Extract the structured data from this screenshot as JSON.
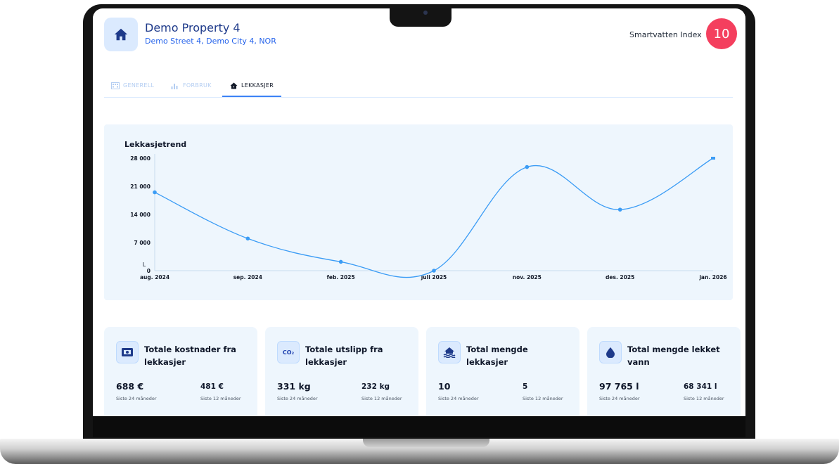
{
  "header": {
    "title": "Demo Property 4",
    "address": "Demo Street 4, Demo City 4, NOR",
    "index_label": "Smartvatten Index",
    "index_value": "10"
  },
  "tabs": [
    {
      "label": "GENERELL",
      "icon": "building-icon",
      "active": false
    },
    {
      "label": "FORBRUK",
      "icon": "bar-chart-icon",
      "active": false
    },
    {
      "label": "LEKKASJER",
      "icon": "house-leak-icon",
      "active": true
    }
  ],
  "chart_data": {
    "type": "line",
    "title": "Lekkasjetrend",
    "ylabel": "L",
    "xlabel": "",
    "categories": [
      "aug. 2024",
      "sep. 2024",
      "feb. 2025",
      "juli 2025",
      "nov. 2025",
      "des. 2025",
      "jan. 2026"
    ],
    "values": [
      19500,
      8000,
      2200,
      0,
      25800,
      15200,
      28000
    ],
    "y_ticks": [
      "0",
      "7 000",
      "14 000",
      "21 000",
      "28 000"
    ],
    "ylim": [
      0,
      28000
    ],
    "grid": false,
    "color": "#3b9cf5"
  },
  "cards": [
    {
      "icon": "money-icon",
      "title": "Totale kostnader fra lekkasjer",
      "left_value": "688 €",
      "left_label": "Siste 24 måneder",
      "right_value": "481 €",
      "right_label": "Siste 12 måneder"
    },
    {
      "icon": "co2-icon",
      "icon_text": "CO₂",
      "title": "Totale utslipp fra lekkasjer",
      "left_value": "331 kg",
      "left_label": "Siste 24 måneder",
      "right_value": "232 kg",
      "right_label": "Siste 12 måneder"
    },
    {
      "icon": "flooded-house-icon",
      "title": "Total mengde lekkasjer",
      "left_value": "10",
      "left_label": "Siste 24 måneder",
      "right_value": "5",
      "right_label": "Siste 12 måneder"
    },
    {
      "icon": "water-drop-icon",
      "title": "Total mengde lekket vann",
      "left_value": "97 765 l",
      "left_label": "Siste 24 måneder",
      "right_value": "68 341 l",
      "right_label": "Siste 12 måneder"
    }
  ],
  "colors": {
    "accent": "#3b82f6",
    "badge": "#f43f5e",
    "panel": "#eef6fd",
    "title": "#1e3a8a"
  }
}
